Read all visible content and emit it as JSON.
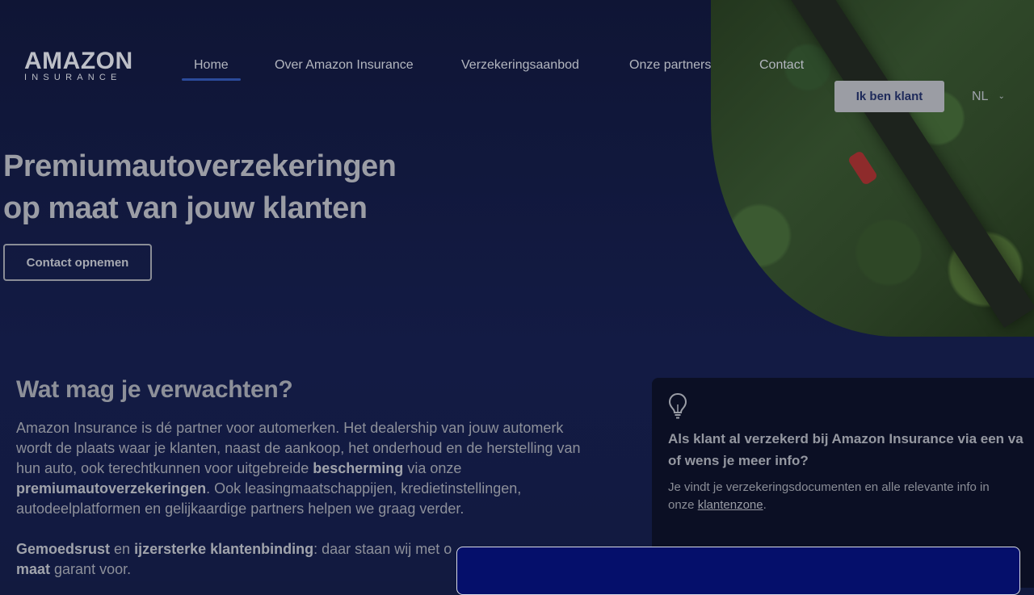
{
  "header": {
    "logo": {
      "line1": "AMAZON",
      "line2": "INSURANCE"
    },
    "nav": [
      {
        "label": "Home",
        "active": true
      },
      {
        "label": "Over Amazon Insurance",
        "active": false
      },
      {
        "label": "Verzekeringsaanbod",
        "active": false
      },
      {
        "label": "Onze partners",
        "active": false
      },
      {
        "label": "Contact",
        "active": false
      }
    ],
    "client_button": "Ik ben klant",
    "language": {
      "selected": "NL",
      "icon": "chevron-down-icon"
    }
  },
  "hero": {
    "title_line1": "Premiumautoverzekeringen",
    "title_line2": "op maat van jouw klanten",
    "cta": "Contact opnemen",
    "image": "aerial-forest-road-with-red-car"
  },
  "expectations": {
    "title": "Wat mag je verwachten?",
    "p1": {
      "t1": "Amazon Insurance is dé partner voor automerken. Het dealership van jouw automerk wordt de plaats waar je klanten, naast de aankoop, het onderhoud en de herstelling van hun auto, ook terechtkunnen voor uitgebreide ",
      "b1": "bescherming",
      "t2": " via onze ",
      "b2": "premiumautoverzekeringen",
      "t3": ". Ook leasingmaatschappijen, kredietinstellingen, autodeelplatformen en gelijkaardige partners helpen we graag verder."
    },
    "p2": {
      "b1": "Gemoedsrust",
      "t1": " en ",
      "b2": "ijzersterke klantenbinding",
      "t2": ": daar staan wij met o",
      "b3": "maat",
      "t3": " garant voor."
    }
  },
  "info_card": {
    "icon": "lightbulb-icon",
    "title_line1": "Als klant al verzekerd bij Amazon Insurance via een va",
    "title_line2": "of wens je meer info?",
    "text": "Je vindt je verzekeringsdocumenten en alle relevante info in onze ",
    "link": "klantenzone",
    "text_end": "."
  },
  "colors": {
    "background": "#121a3f",
    "accent_underline": "#2b4a9a",
    "overlay_panel": "#050f6b"
  }
}
